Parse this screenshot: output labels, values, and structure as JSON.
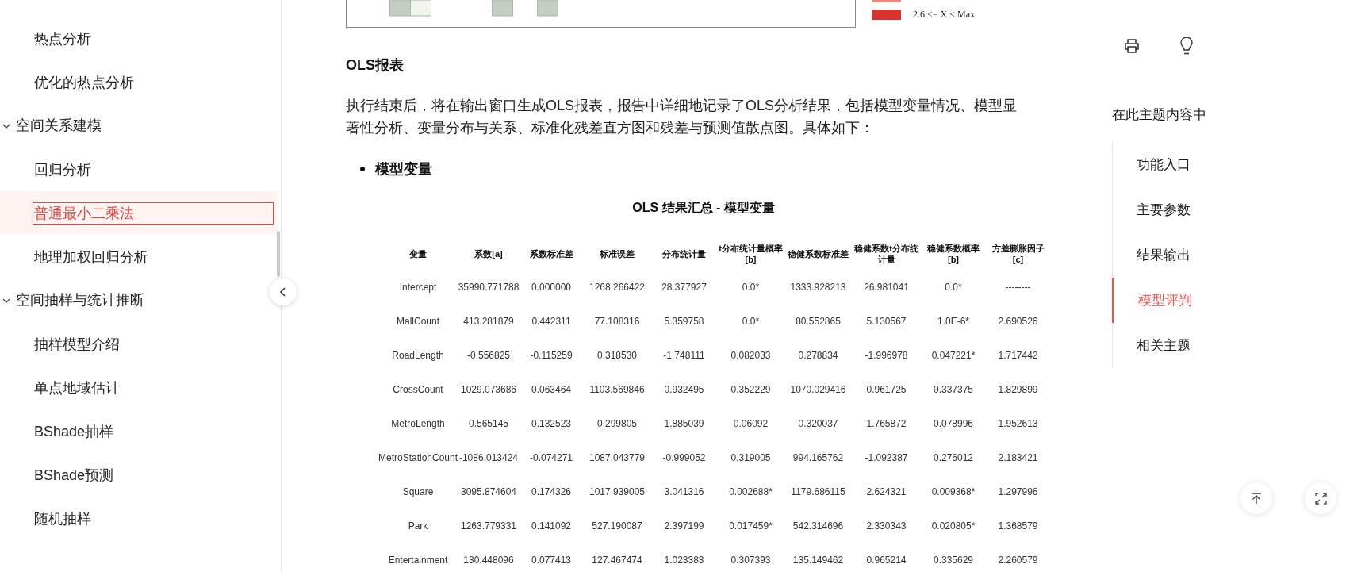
{
  "sidebar": {
    "items": [
      {
        "kind": "item",
        "label": "热点分析",
        "selected": false
      },
      {
        "kind": "item",
        "label": "优化的热点分析",
        "selected": false
      },
      {
        "kind": "group",
        "label": "空间关系建模",
        "expanded": true,
        "children": [
          {
            "kind": "item",
            "label": "回归分析",
            "selected": false
          },
          {
            "kind": "item",
            "label": "普通最小二乘法",
            "selected": true
          },
          {
            "kind": "item",
            "label": "地理加权回归分析",
            "selected": false
          }
        ]
      },
      {
        "kind": "group",
        "label": "空间抽样与统计推断",
        "expanded": true,
        "children": [
          {
            "kind": "item",
            "label": "抽样模型介绍",
            "selected": false
          },
          {
            "kind": "item",
            "label": "单点地域估计",
            "selected": false
          },
          {
            "kind": "item",
            "label": "BShade抽样",
            "selected": false
          },
          {
            "kind": "item",
            "label": "BShade预测",
            "selected": false
          },
          {
            "kind": "item",
            "label": "随机抽样",
            "selected": false
          }
        ]
      }
    ]
  },
  "content": {
    "figure_legend": [
      {
        "label": "2.6 <= X < Max",
        "color": "#d9332b"
      }
    ],
    "heading": "OLS报表",
    "paragraph": "执行结束后，将在输出窗口生成OLS报表，报告中详细地记录了OLS分析结果，包括模型变量情况、模型显著性分析、变量分布与关系、标准化残差直方图和残差与预测值散点图。具体如下：",
    "bullets": [
      "模型变量"
    ],
    "table": {
      "title": "OLS 结果汇总 - 模型变量",
      "columns": [
        "变量",
        "系数[a]",
        "系数标准差",
        "标准误差",
        "分布统计量",
        "t分布统计量概率[b]",
        "稳健系数标准差",
        "稳健系数t分布统计量",
        "稳健系数概率[b]",
        "方差膨胀因子[c]"
      ],
      "rows": [
        [
          "Intercept",
          "35990.771788",
          "0.000000",
          "1268.266422",
          "28.377927",
          "0.0*",
          "1333.928213",
          "26.981041",
          "0.0*",
          "--------"
        ],
        [
          "MallCount",
          "413.281879",
          "0.442311",
          "77.108316",
          "5.359758",
          "0.0*",
          "80.552865",
          "5.130567",
          "1.0E-6*",
          "2.690526"
        ],
        [
          "RoadLength",
          "-0.556825",
          "-0.115259",
          "0.318530",
          "-1.748111",
          "0.082033",
          "0.278834",
          "-1.996978",
          "0.047221*",
          "1.717442"
        ],
        [
          "CrossCount",
          "1029.073686",
          "0.063464",
          "1103.569846",
          "0.932495",
          "0.352229",
          "1070.029416",
          "0.961725",
          "0.337375",
          "1.829899"
        ],
        [
          "MetroLength",
          "0.565145",
          "0.132523",
          "0.299805",
          "1.885039",
          "0.06092",
          "0.320037",
          "1.765872",
          "0.078996",
          "1.952613"
        ],
        [
          "MetroStationCount",
          "-1086.013424",
          "-0.074271",
          "1087.043779",
          "-0.999052",
          "0.319005",
          "994.165762",
          "-1.092387",
          "0.276012",
          "2.183421"
        ],
        [
          "Square",
          "3095.874604",
          "0.174326",
          "1017.939005",
          "3.041316",
          "0.002688*",
          "1179.686115",
          "2.624321",
          "0.009368*",
          "1.297996"
        ],
        [
          "Park",
          "1263.779331",
          "0.141092",
          "527.190087",
          "2.397199",
          "0.017459*",
          "542.314696",
          "2.330343",
          "0.020805*",
          "1.368579"
        ],
        [
          "Entertainment",
          "130.448096",
          "0.077413",
          "127.467474",
          "1.023383",
          "0.307393",
          "135.149462",
          "0.965214",
          "0.335629",
          "2.260579"
        ]
      ]
    }
  },
  "toc": {
    "title": "在此主题内容中",
    "items": [
      {
        "label": "功能入口",
        "selected": false
      },
      {
        "label": "主要参数",
        "selected": false
      },
      {
        "label": "结果输出",
        "selected": false
      },
      {
        "label": "模型评判",
        "selected": true
      },
      {
        "label": "相关主题",
        "selected": false
      }
    ]
  }
}
